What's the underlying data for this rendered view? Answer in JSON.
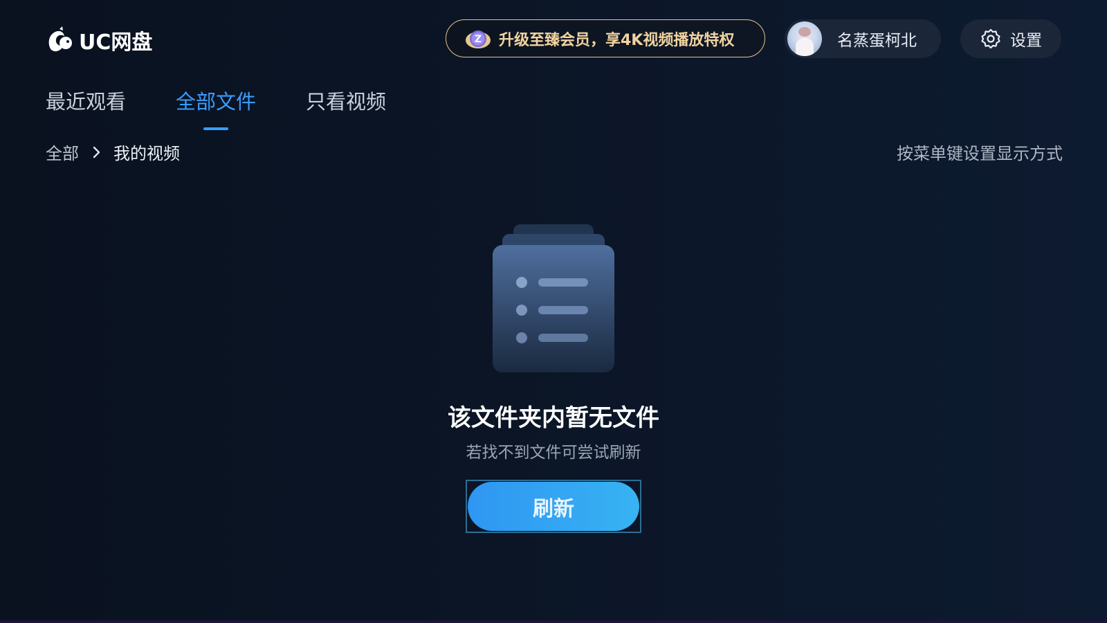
{
  "app": {
    "name": "UC网盘"
  },
  "header": {
    "promo_text": "升级至臻会员，享4K视频播放特权",
    "promo_icon": "z-badge-cloud-icon",
    "user_name": "名蒸蛋柯北",
    "settings_label": "设置",
    "settings_icon": "gear-icon"
  },
  "tabs": [
    {
      "label": "最近观看",
      "active": false
    },
    {
      "label": "全部文件",
      "active": true
    },
    {
      "label": "只看视频",
      "active": false
    }
  ],
  "breadcrumb": {
    "root": "全部",
    "current": "我的视频"
  },
  "hint": "按菜单键设置显示方式",
  "empty_state": {
    "title": "该文件夹内暂无文件",
    "subtitle": "若找不到文件可尝试刷新",
    "button_label": "刷新"
  },
  "colors": {
    "accent": "#3a9cff",
    "promo_gold": "#f1d39f",
    "button_start": "#2f96f2",
    "button_end": "#37b3f2"
  }
}
